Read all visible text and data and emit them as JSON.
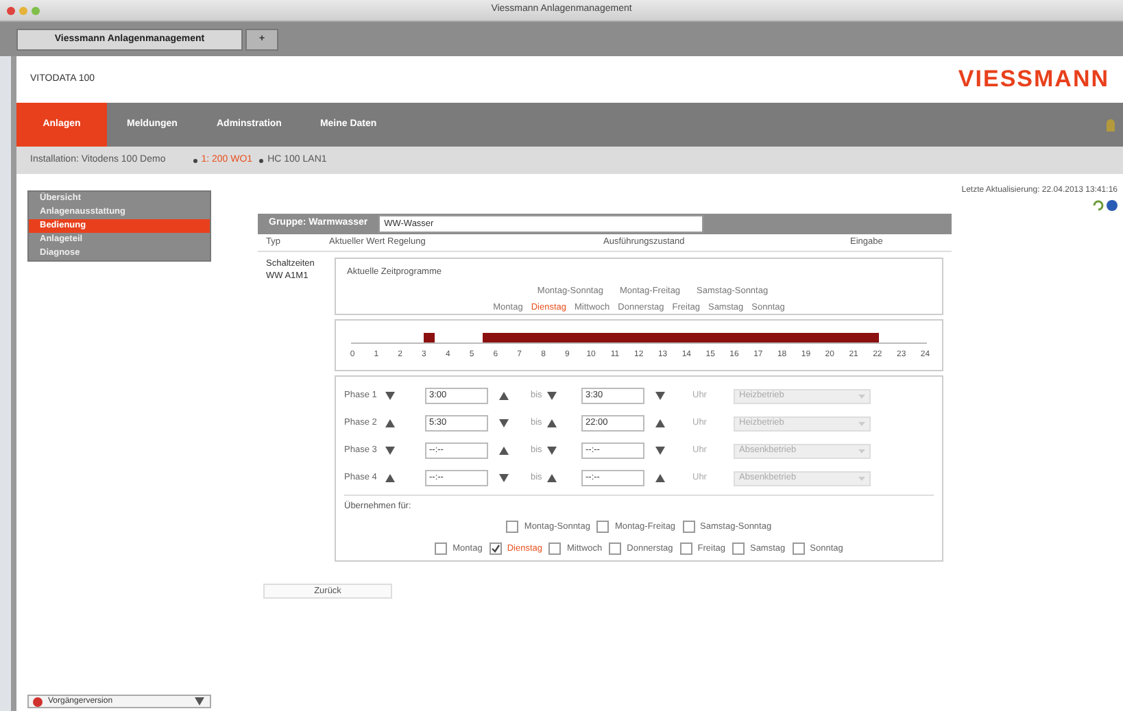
{
  "window": {
    "title": "Viessmann Anlagenmanagement"
  },
  "browser_tabs": [
    {
      "label": "Viessmann Anlagenmanagement",
      "selected": true
    },
    {
      "label": "+",
      "selected": false
    }
  ],
  "header": {
    "device": "VITODATA 100",
    "logo": "VIESSMANN"
  },
  "nav": [
    {
      "label": "Anlagen",
      "selected": true
    },
    {
      "label": "Meldungen",
      "selected": false
    },
    {
      "label": "Adminstration",
      "selected": false
    },
    {
      "label": "Meine Daten",
      "selected": false
    }
  ],
  "breadcrumb": {
    "installation": "Installation: Vitodens 100 Demo",
    "items": [
      {
        "label": "1: 200 WO1",
        "selected": true
      },
      {
        "label": "HC 100 LAN1",
        "selected": false
      }
    ]
  },
  "sidebar": [
    {
      "label": "Übersicht",
      "selected": false
    },
    {
      "label": "Anlagenausstattung",
      "selected": false
    },
    {
      "label": "Bedienung",
      "selected": true
    },
    {
      "label": "Anlageteil",
      "selected": false
    },
    {
      "label": "Diagnose",
      "selected": false
    }
  ],
  "last_update": "Letzte Aktualisierung: 22.04.2013 13:41:16",
  "group": {
    "label": "Gruppe: Warmwasser",
    "value": "WW-Wasser"
  },
  "columns": [
    "Typ",
    "Aktueller Wert Regelung",
    "Ausführungszustand",
    "Eingabe"
  ],
  "row_label": "Schaltzeiten WW A1M1",
  "programs_title": "Aktuelle Zeitprogramme",
  "program_groups": [
    {
      "label": "Montag-Sonntag",
      "selected": false
    },
    {
      "label": "Montag-Freitag",
      "selected": false
    },
    {
      "label": "Samstag-Sonntag",
      "selected": false
    }
  ],
  "days": [
    {
      "label": "Montag",
      "selected": false
    },
    {
      "label": "Dienstag",
      "selected": true
    },
    {
      "label": "Mittwoch",
      "selected": false
    },
    {
      "label": "Donnerstag",
      "selected": false
    },
    {
      "label": "Freitag",
      "selected": false
    },
    {
      "label": "Samstag",
      "selected": false
    },
    {
      "label": "Sonntag",
      "selected": false
    }
  ],
  "hours": [
    "0",
    "1",
    "2",
    "3",
    "4",
    "5",
    "6",
    "7",
    "8",
    "9",
    "10",
    "11",
    "12",
    "13",
    "14",
    "15",
    "16",
    "17",
    "18",
    "19",
    "20",
    "21",
    "22",
    "23",
    "24"
  ],
  "phases": [
    {
      "label": "Phase 1",
      "from": "3:00",
      "bis": "bis",
      "to": "3:30",
      "uhr": "Uhr",
      "mode": "Heizbetrieb"
    },
    {
      "label": "Phase 2",
      "from": "5:30",
      "bis": "bis",
      "to": "22:00",
      "uhr": "Uhr",
      "mode": "Heizbetrieb"
    },
    {
      "label": "Phase 3",
      "from": "--:--",
      "bis": "bis",
      "to": "--:--",
      "uhr": "Uhr",
      "mode": "Absenkbetrieb"
    },
    {
      "label": "Phase 4",
      "from": "--:--",
      "bis": "bis",
      "to": "--:--",
      "uhr": "Uhr",
      "mode": "Absenkbetrieb"
    }
  ],
  "copy_label": "Übernehmen für:",
  "copy_groups": [
    {
      "label": "Montag-Sonntag",
      "checked": false
    },
    {
      "label": "Montag-Freitag",
      "checked": false
    },
    {
      "label": "Samstag-Sonntag",
      "checked": false
    }
  ],
  "copy_days": [
    {
      "label": "Montag",
      "checked": false
    },
    {
      "label": "Dienstag",
      "checked": true
    },
    {
      "label": "Mittwoch",
      "checked": false
    },
    {
      "label": "Donnerstag",
      "checked": false
    },
    {
      "label": "Freitag",
      "checked": false
    },
    {
      "label": "Samstag",
      "checked": false
    },
    {
      "label": "Sonntag",
      "checked": false
    }
  ],
  "back_button": "Zurück",
  "bottom_select": "Vorgängerversion"
}
